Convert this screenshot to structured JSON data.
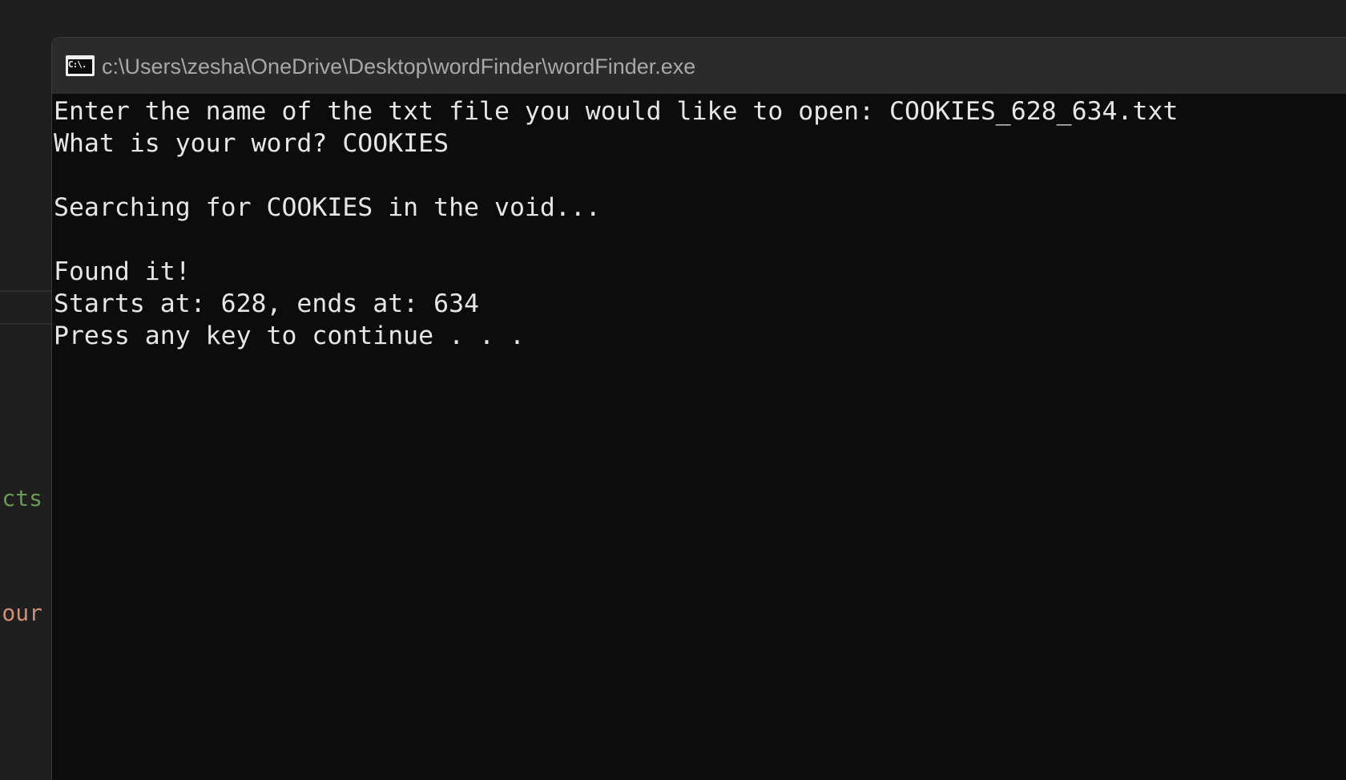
{
  "window": {
    "title": "c:\\Users\\zesha\\OneDrive\\Desktop\\wordFinder\\wordFinder.exe",
    "icon": "console-app-icon",
    "icon_glyph": "C:\\."
  },
  "console": {
    "lines": [
      "Enter the name of the txt file you would like to open: COOKIES_628_634.txt",
      "What is your word? COOKIES",
      "",
      "Searching for COOKIES in the void...",
      "",
      "Found it!",
      "Starts at: 628, ends at: 634",
      "Press any key to continue . . ."
    ]
  },
  "background_editor": {
    "fragments": [
      "cts",
      "our"
    ],
    "fragment_colors": [
      "#6a9955",
      "#ce9178"
    ]
  },
  "colors": {
    "console_bg": "#0c0c0c",
    "titlebar_bg": "#2b2b2b",
    "console_text": "#e6e6e6",
    "title_text": "#a8a8a8"
  }
}
